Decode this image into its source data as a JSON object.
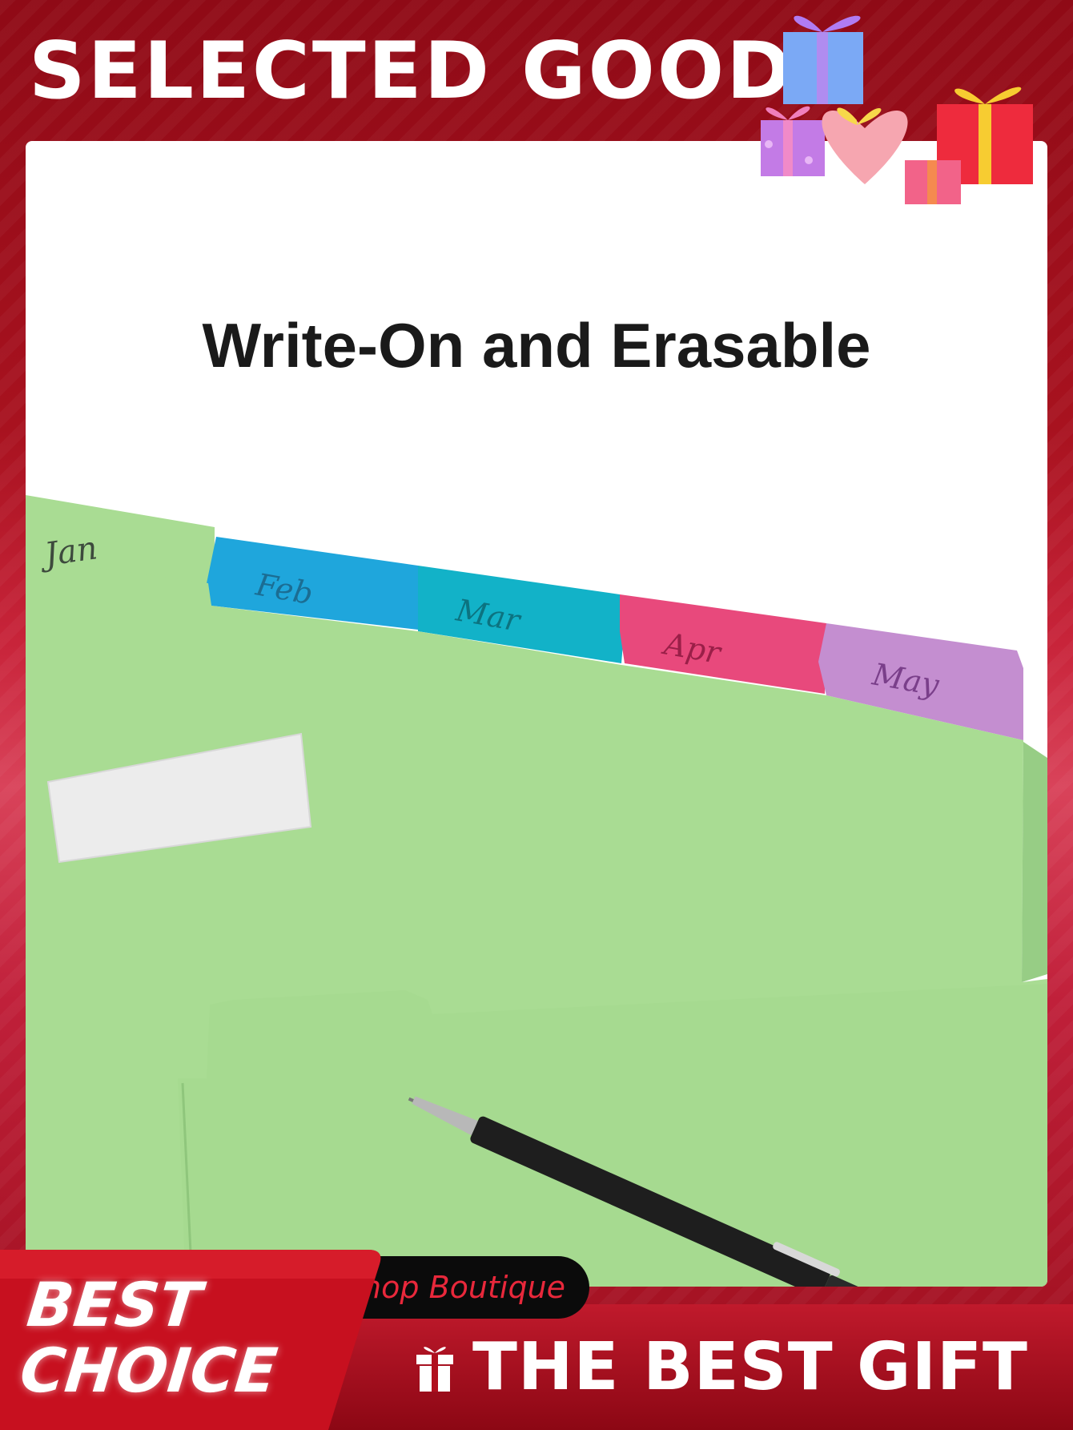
{
  "header": {
    "title": "SELECTED GOODS"
  },
  "product": {
    "headline": "Write-On and Erasable",
    "tab_labels": [
      "Jan",
      "Feb",
      "Mar",
      "Apr",
      "May"
    ]
  },
  "badge": {
    "line1": "BEST",
    "line2": "CHOICE"
  },
  "shop": {
    "label": "Shop Boutique"
  },
  "footer": {
    "label": "THE BEST GIFT",
    "icon": "gift-icon"
  },
  "colors": {
    "frame_red": "#a8121f",
    "folder_green": "#a9dc93",
    "tab_blue": "#1fa6dc",
    "tab_teal": "#12b2c8",
    "tab_pink": "#e8497c",
    "tab_purple": "#c48ed0",
    "pill_text": "#e8283b"
  }
}
